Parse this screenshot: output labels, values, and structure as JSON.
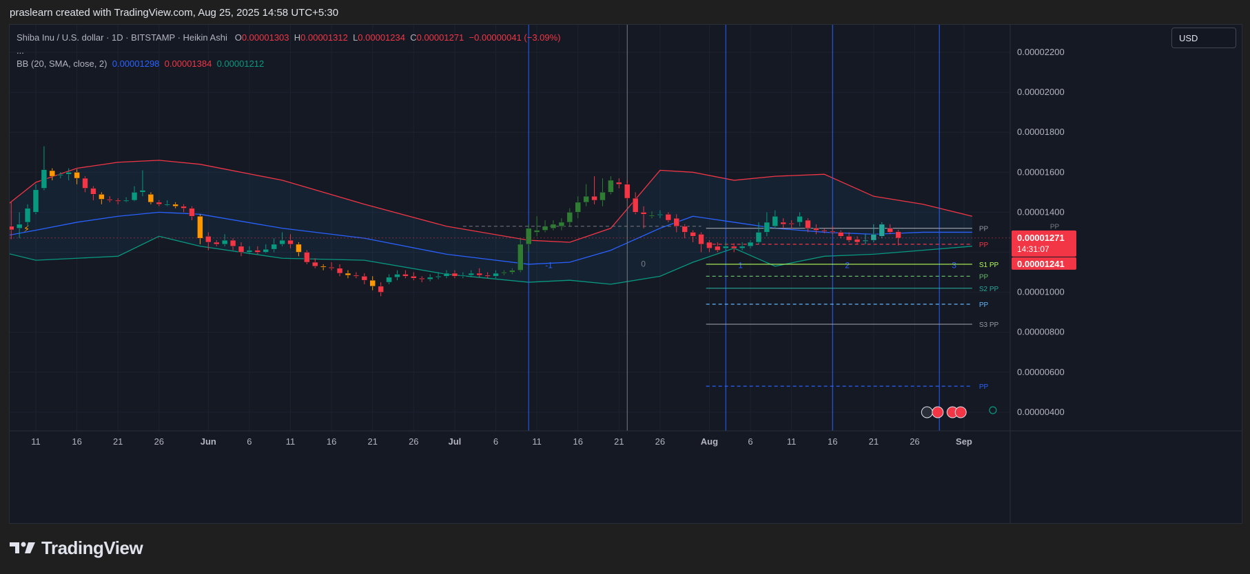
{
  "header": {
    "caption": "praslearn created with TradingView.com, Aug 25, 2025 14:58 UTC+5:30"
  },
  "legend": {
    "symbol": "Shiba Inu / U.S. dollar · 1D · BITSTAMP · Heikin Ashi",
    "o_label": "O",
    "o_value": "0.00001303",
    "h_label": "H",
    "h_value": "0.00001312",
    "l_label": "L",
    "l_value": "0.00001234",
    "c_label": "C",
    "c_value": "0.00001271",
    "change": "−0.00000041 (−3.09%)",
    "more": "...",
    "bb_label": "BB (20, SMA, close, 2)",
    "bb_basis": "0.00001298",
    "bb_upper": "0.00001384",
    "bb_lower": "0.00001212"
  },
  "currency_button": {
    "label": "USD"
  },
  "brand": {
    "name": "TradingView"
  },
  "colors": {
    "up": "#089981",
    "down": "#f23645",
    "up_alt": "#26a69a",
    "down_alt": "#ff9800",
    "bb_upper": "#f23645",
    "bb_basis": "#2962ff",
    "bb_lower": "#089981",
    "price_badge": "#f23645"
  },
  "price_badges": {
    "last_price": "0.00001271",
    "countdown": "14:31:07",
    "second_price": "0.00001241"
  },
  "pivot_labels": {
    "pp": "PP",
    "s1": "S1 PP",
    "s2": "S2 PP",
    "s3": "S3 PP"
  },
  "cycle_labels": [
    "-1",
    "0",
    "1",
    "2",
    "3"
  ],
  "chart_data": {
    "type": "candlestick",
    "title": "Shiba Inu / U.S. dollar · 1D · BITSTAMP · Heikin Ashi",
    "y_axis_ticks": [
      "0.00002200",
      "0.00002000",
      "0.00001800",
      "0.00001600",
      "0.00001400",
      "0.00001200",
      "0.00001000",
      "0.00000800",
      "0.00000600",
      "0.00000400"
    ],
    "ylim": [
      3.5e-06,
      2.29e-05
    ],
    "x_axis_ticks": [
      "11",
      "16",
      "21",
      "26",
      "Jun",
      "6",
      "11",
      "16",
      "21",
      "26",
      "Jul",
      "6",
      "11",
      "16",
      "21",
      "26",
      "Aug",
      "6",
      "11",
      "16",
      "21",
      "26",
      "Sep"
    ],
    "x_axis_tick_days": [
      10,
      15,
      20,
      25,
      31,
      36,
      41,
      46,
      51,
      56,
      61,
      66,
      71,
      76,
      81,
      86,
      92,
      97,
      102,
      107,
      112,
      117,
      123
    ],
    "x_axis_day_zero": "May 1",
    "first_candle_day": 6,
    "candles": [
      [
        1312,
        1312,
        1270,
        1382
      ],
      [
        1330,
        1312,
        1265,
        1450
      ],
      [
        1320,
        1340,
        1270,
        1400
      ],
      [
        1350,
        1420,
        1330,
        1440
      ],
      [
        1400,
        1513,
        1390,
        1540
      ],
      [
        1520,
        1613,
        1510,
        1730
      ],
      [
        1608,
        1580,
        1560,
        1620
      ],
      [
        1585,
        1589,
        1570,
        1600
      ],
      [
        1590,
        1600,
        1560,
        1620
      ],
      [
        1600,
        1570,
        1540,
        1615
      ],
      [
        1570,
        1520,
        1500,
        1580
      ],
      [
        1520,
        1490,
        1460,
        1530
      ],
      [
        1490,
        1465,
        1440,
        1500
      ],
      [
        1465,
        1460,
        1450,
        1480
      ],
      [
        1460,
        1455,
        1440,
        1470
      ],
      [
        1455,
        1460,
        1450,
        1475
      ],
      [
        1460,
        1500,
        1455,
        1530
      ],
      [
        1500,
        1510,
        1480,
        1610
      ],
      [
        1490,
        1450,
        1440,
        1500
      ],
      [
        1450,
        1440,
        1430,
        1460
      ],
      [
        1440,
        1440,
        1430,
        1460
      ],
      [
        1440,
        1430,
        1420,
        1450
      ],
      [
        1430,
        1420,
        1400,
        1440
      ],
      [
        1420,
        1380,
        1360,
        1430
      ],
      [
        1380,
        1270,
        1240,
        1390
      ],
      [
        1280,
        1250,
        1210,
        1300
      ],
      [
        1250,
        1240,
        1230,
        1260
      ],
      [
        1240,
        1260,
        1230,
        1290
      ],
      [
        1260,
        1230,
        1210,
        1270
      ],
      [
        1230,
        1200,
        1180,
        1250
      ],
      [
        1200,
        1210,
        1190,
        1230
      ],
      [
        1210,
        1200,
        1190,
        1230
      ],
      [
        1200,
        1215,
        1195,
        1240
      ],
      [
        1215,
        1240,
        1200,
        1270
      ],
      [
        1240,
        1260,
        1230,
        1300
      ],
      [
        1260,
        1240,
        1220,
        1290
      ],
      [
        1240,
        1200,
        1180,
        1250
      ],
      [
        1200,
        1150,
        1140,
        1210
      ],
      [
        1150,
        1130,
        1120,
        1170
      ],
      [
        1130,
        1125,
        1110,
        1140
      ],
      [
        1125,
        1120,
        1110,
        1150
      ],
      [
        1120,
        1095,
        1080,
        1140
      ],
      [
        1095,
        1085,
        1070,
        1110
      ],
      [
        1085,
        1080,
        1070,
        1100
      ],
      [
        1080,
        1060,
        1040,
        1095
      ],
      [
        1060,
        1030,
        1010,
        1080
      ],
      [
        1030,
        1000,
        980,
        1050
      ],
      [
        1050,
        1075,
        1040,
        1090
      ],
      [
        1075,
        1090,
        1060,
        1110
      ],
      [
        1090,
        1080,
        1070,
        1110
      ],
      [
        1080,
        1070,
        1060,
        1100
      ],
      [
        1070,
        1065,
        1050,
        1080
      ],
      [
        1065,
        1075,
        1055,
        1090
      ],
      [
        1075,
        1080,
        1065,
        1100
      ],
      [
        1080,
        1095,
        1070,
        1110
      ],
      [
        1095,
        1080,
        1070,
        1110
      ],
      [
        1080,
        1085,
        1070,
        1100
      ],
      [
        1085,
        1095,
        1075,
        1110
      ],
      [
        1095,
        1085,
        1075,
        1120
      ],
      [
        1085,
        1080,
        1070,
        1100
      ],
      [
        1080,
        1095,
        1070,
        1110
      ],
      [
        1095,
        1100,
        1085,
        1110
      ],
      [
        1100,
        1110,
        1090,
        1120
      ],
      [
        1110,
        1240,
        1100,
        1270
      ],
      [
        1240,
        1320,
        1200,
        1340
      ],
      [
        1300,
        1310,
        1280,
        1380
      ],
      [
        1310,
        1330,
        1300,
        1360
      ],
      [
        1320,
        1340,
        1310,
        1360
      ],
      [
        1330,
        1350,
        1310,
        1370
      ],
      [
        1350,
        1400,
        1330,
        1420
      ],
      [
        1400,
        1450,
        1370,
        1480
      ],
      [
        1450,
        1480,
        1430,
        1540
      ],
      [
        1480,
        1460,
        1440,
        1580
      ],
      [
        1460,
        1500,
        1430,
        1570
      ],
      [
        1500,
        1560,
        1490,
        1580
      ],
      [
        1550,
        1540,
        1520,
        1570
      ],
      [
        1540,
        1470,
        1460,
        1560
      ],
      [
        1470,
        1400,
        1390,
        1500
      ],
      [
        1400,
        1390,
        1320,
        1430
      ],
      [
        1385,
        1385,
        1370,
        1405
      ],
      [
        1385,
        1390,
        1370,
        1410
      ],
      [
        1390,
        1360,
        1350,
        1400
      ],
      [
        1370,
        1330,
        1300,
        1390
      ],
      [
        1330,
        1300,
        1270,
        1340
      ],
      [
        1300,
        1280,
        1250,
        1310
      ],
      [
        1290,
        1240,
        1200,
        1300
      ],
      [
        1250,
        1220,
        1200,
        1260
      ],
      [
        1230,
        1210,
        1200,
        1250
      ],
      [
        1220,
        1230,
        1210,
        1250
      ],
      [
        1230,
        1220,
        1200,
        1245
      ],
      [
        1220,
        1230,
        1210,
        1250
      ],
      [
        1230,
        1250,
        1220,
        1260
      ],
      [
        1250,
        1300,
        1240,
        1350
      ],
      [
        1300,
        1350,
        1280,
        1400
      ],
      [
        1330,
        1380,
        1320,
        1410
      ],
      [
        1350,
        1340,
        1320,
        1370
      ],
      [
        1345,
        1340,
        1320,
        1360
      ],
      [
        1350,
        1380,
        1330,
        1400
      ],
      [
        1360,
        1320,
        1300,
        1370
      ],
      [
        1320,
        1310,
        1290,
        1340
      ],
      [
        1310,
        1305,
        1295,
        1320
      ],
      [
        1305,
        1300,
        1290,
        1330
      ],
      [
        1300,
        1280,
        1270,
        1310
      ],
      [
        1280,
        1260,
        1250,
        1300
      ],
      [
        1265,
        1250,
        1240,
        1280
      ],
      [
        1255,
        1260,
        1240,
        1290
      ],
      [
        1260,
        1290,
        1250,
        1340
      ],
      [
        1280,
        1340,
        1270,
        1350
      ],
      [
        1320,
        1300,
        1290,
        1340
      ],
      [
        1303,
        1271,
        1234,
        1312
      ]
    ],
    "candle_units": "1e-8 USD (open, close, low, high)",
    "bollinger_bands": {
      "label": "BB (20, SMA, close, 2)",
      "upper_points": [
        [
          6,
          1420
        ],
        [
          10,
          1550
        ],
        [
          15,
          1620
        ],
        [
          20,
          1650
        ],
        [
          25,
          1660
        ],
        [
          30,
          1640
        ],
        [
          40,
          1560
        ],
        [
          50,
          1440
        ],
        [
          60,
          1330
        ],
        [
          70,
          1260
        ],
        [
          75,
          1250
        ],
        [
          80,
          1320
        ],
        [
          86,
          1610
        ],
        [
          90,
          1600
        ],
        [
          95,
          1560
        ],
        [
          100,
          1580
        ],
        [
          106,
          1590
        ],
        [
          112,
          1480
        ],
        [
          118,
          1440
        ],
        [
          124,
          1380
        ]
      ],
      "basis_points": [
        [
          6,
          1280
        ],
        [
          10,
          1310
        ],
        [
          15,
          1350
        ],
        [
          20,
          1380
        ],
        [
          25,
          1400
        ],
        [
          30,
          1390
        ],
        [
          40,
          1320
        ],
        [
          50,
          1270
        ],
        [
          60,
          1190
        ],
        [
          70,
          1140
        ],
        [
          75,
          1150
        ],
        [
          80,
          1210
        ],
        [
          86,
          1320
        ],
        [
          90,
          1380
        ],
        [
          95,
          1350
        ],
        [
          100,
          1320
        ],
        [
          106,
          1300
        ],
        [
          112,
          1290
        ],
        [
          118,
          1300
        ],
        [
          124,
          1300
        ]
      ],
      "lower_points": [
        [
          6,
          1200
        ],
        [
          10,
          1160
        ],
        [
          15,
          1170
        ],
        [
          20,
          1180
        ],
        [
          25,
          1280
        ],
        [
          30,
          1230
        ],
        [
          40,
          1170
        ],
        [
          50,
          1160
        ],
        [
          60,
          1090
        ],
        [
          70,
          1050
        ],
        [
          75,
          1060
        ],
        [
          80,
          1040
        ],
        [
          86,
          1080
        ],
        [
          90,
          1150
        ],
        [
          95,
          1220
        ],
        [
          100,
          1130
        ],
        [
          106,
          1180
        ],
        [
          112,
          1190
        ],
        [
          118,
          1210
        ],
        [
          124,
          1230
        ]
      ]
    },
    "vertical_cycle_lines_days": [
      70,
      82,
      94,
      107,
      120
    ],
    "pivot_lines": [
      {
        "name": "PP",
        "value": 1320,
        "style": "solid",
        "color": "#9598a1"
      },
      {
        "name": "PP",
        "value": 1240,
        "style": "dashed",
        "color": "#f23645"
      },
      {
        "name": "S1 PP",
        "value": 1140,
        "style": "solid",
        "color": "#b2ff59"
      },
      {
        "name": "PP",
        "value": 1080,
        "style": "dashed",
        "color": "#66bb6a"
      },
      {
        "name": "S2 PP",
        "value": 1020,
        "style": "solid",
        "color": "#26a69a"
      },
      {
        "name": "PP",
        "value": 940,
        "style": "dashed",
        "color": "#64b5f6"
      },
      {
        "name": "S3 PP",
        "value": 840,
        "style": "solid",
        "color": "#9598a1"
      },
      {
        "name": "PP",
        "value": 530,
        "style": "dashed",
        "color": "#2962ff"
      }
    ],
    "previous_pp_value": 1330,
    "last_price": 1271,
    "grid": true
  }
}
